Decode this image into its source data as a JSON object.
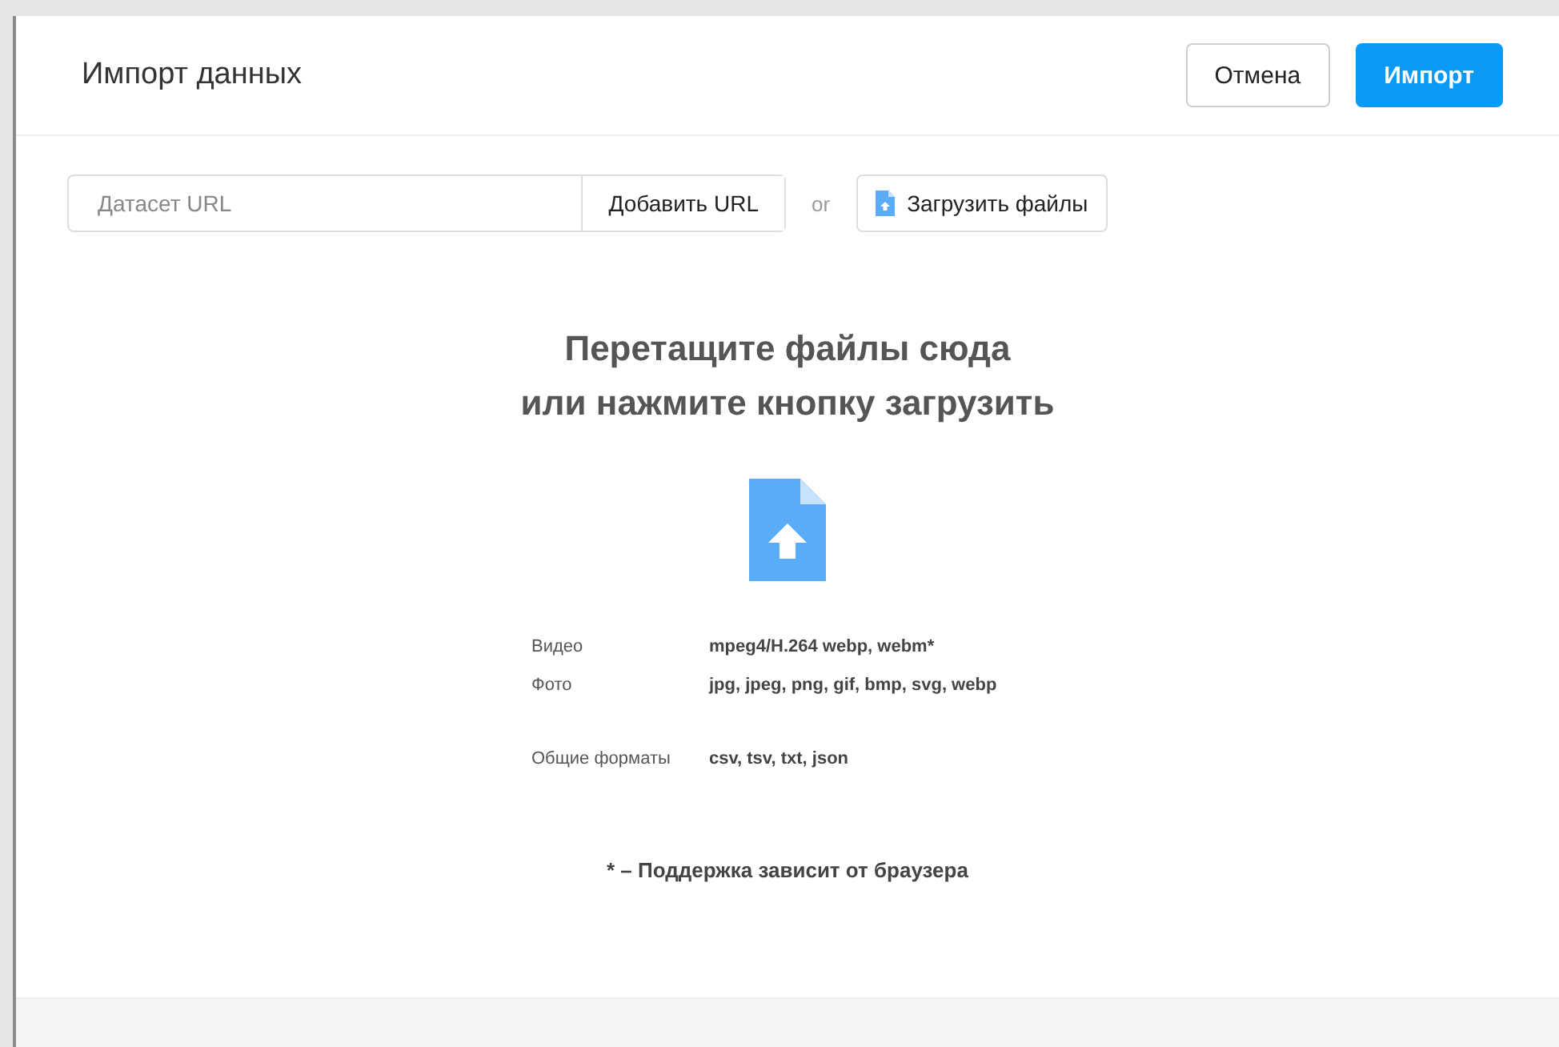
{
  "dialog": {
    "title": "Импорт данных",
    "buttons": [
      {
        "label": "Отмена",
        "kind": "secondary"
      },
      {
        "label": "Импорт",
        "kind": "primary"
      }
    ]
  },
  "url_row": {
    "placeholder": "Датасет URL",
    "add_button": "Добавить URL",
    "separator": "or",
    "upload_button": "Загрузить файлы"
  },
  "drop_zone": {
    "heading_lines": [
      "Перетащите файлы сюда",
      "или нажмите кнопку загрузить"
    ],
    "format_groups": [
      [
        {
          "label": "Видео",
          "value": "mpeg4/H.264 webp, webm*"
        },
        {
          "label": "Фото",
          "value": "jpg, jpeg, png, gif, bmp, svg, webp"
        }
      ],
      [
        {
          "label": "Общие форматы",
          "value": "csv, tsv, txt, json"
        }
      ]
    ],
    "note": "* – Поддержка зависит от браузера"
  }
}
